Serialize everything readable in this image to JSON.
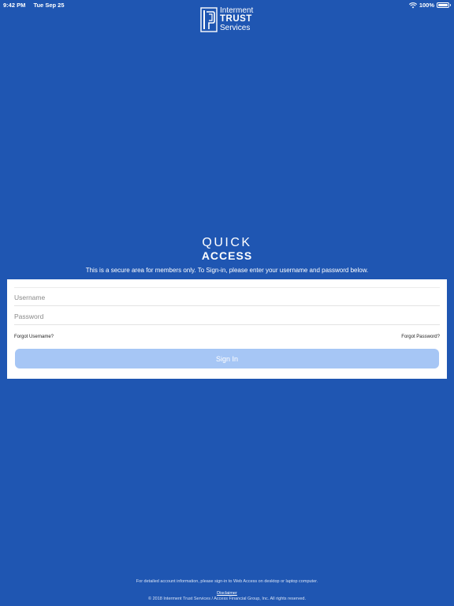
{
  "status_bar": {
    "time": "9:42 PM",
    "date": "Tue Sep 25",
    "battery": "100%",
    "wifi_icon": "wifi-icon",
    "battery_icon": "battery-icon"
  },
  "logo": {
    "line1": "Interment",
    "line2": "TRUST",
    "line3": "Services"
  },
  "quick_access": {
    "line1": "QUICK",
    "line2": "ACCESS"
  },
  "secure_message": "This is a secure area for members only. To Sign-in, please enter your username and password below.",
  "login": {
    "username_placeholder": "Username",
    "password_placeholder": "Password",
    "forgot_username": "Forgot Username?",
    "forgot_password": "Forgot Password?",
    "signin_label": "Sign In"
  },
  "footer": {
    "info": "For detailed account information, please sign-in to Web Access on desktop or laptop computer.",
    "disclaimer": "Disclaimer",
    "copyright": "© 2018 Interment Trust Services / Access Financial Group, Inc. All rights reserved."
  },
  "colors": {
    "background": "#1f56b2",
    "button": "#a6c6f5",
    "card": "#ffffff"
  }
}
